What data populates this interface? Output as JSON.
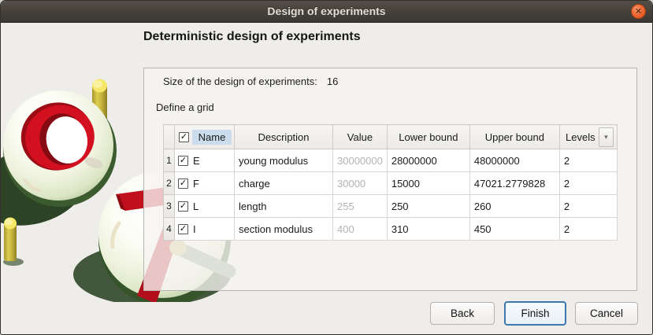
{
  "window": {
    "title": "Design of experiments"
  },
  "icons": {
    "close": "✕",
    "check": "✓",
    "dropdown_arrow": "▾"
  },
  "page": {
    "heading": "Deterministic design of experiments",
    "size_label": "Size of the design of experiments:",
    "size_value": "16",
    "grid_label": "Define a grid"
  },
  "table": {
    "headers": {
      "name": "Name",
      "description": "Description",
      "value": "Value",
      "lower": "Lower bound",
      "upper": "Upper bound",
      "levels": "Levels"
    },
    "header_checkbox_checked": true,
    "rows": [
      {
        "num": "1",
        "checked": true,
        "name": "E",
        "description": "young modulus",
        "value": "30000000",
        "lower": "28000000",
        "upper": "48000000",
        "levels": "2"
      },
      {
        "num": "2",
        "checked": true,
        "name": "F",
        "description": "charge",
        "value": "30000",
        "lower": "15000",
        "upper": "47021.2779828",
        "levels": "2"
      },
      {
        "num": "3",
        "checked": true,
        "name": "L",
        "description": "length",
        "value": "255",
        "lower": "250",
        "upper": "260",
        "levels": "2"
      },
      {
        "num": "4",
        "checked": true,
        "name": "I",
        "description": "section modulus",
        "value": "400",
        "lower": "310",
        "upper": "450",
        "levels": "2"
      }
    ]
  },
  "buttons": {
    "back": "Back",
    "finish": "Finish",
    "cancel": "Cancel"
  },
  "colors": {
    "titlebar": "#454139",
    "close_button": "#ee6a35",
    "dialog_bg": "#efedea",
    "header_highlight": "#cbdded",
    "finish_border": "#3b79ae",
    "logo_red": "#cf0f1e",
    "logo_peg_yellow": "#d9c94a"
  }
}
